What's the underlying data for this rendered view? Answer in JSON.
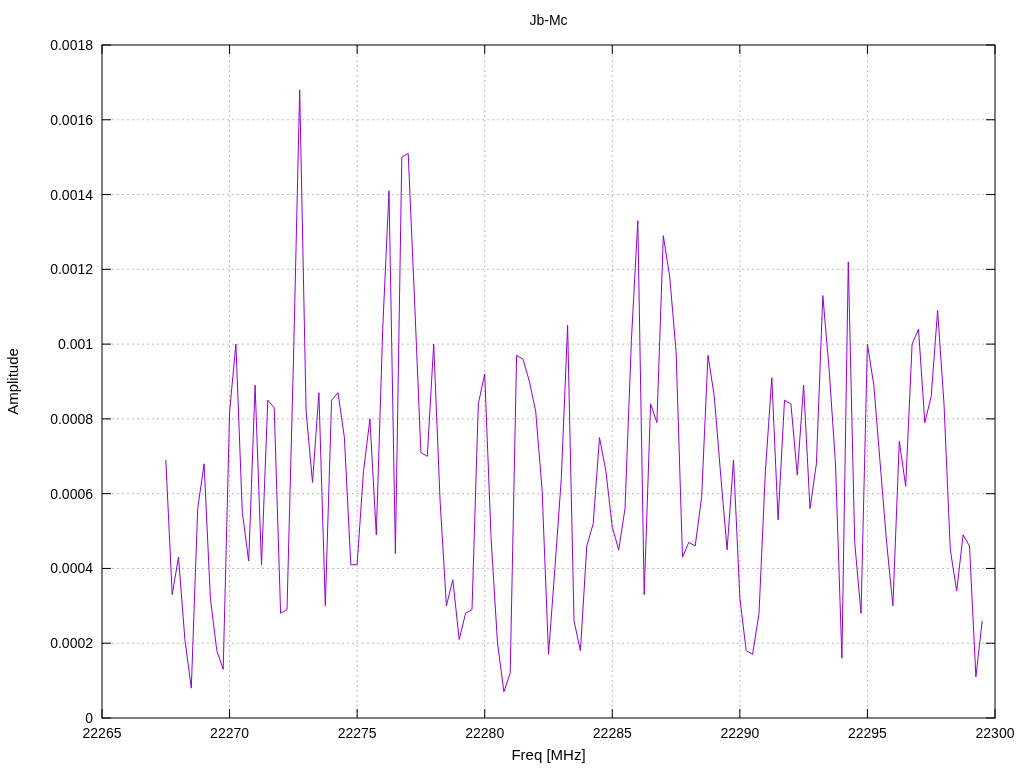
{
  "chart_data": {
    "type": "line",
    "title": "Jb-Mc",
    "xlabel": "Freq [MHz]",
    "ylabel": "Amplitude",
    "xlim": [
      22265,
      22300
    ],
    "grid": true,
    "ylim": [
      0,
      0.0018
    ],
    "xticks": [
      22265,
      22270,
      22275,
      22280,
      22285,
      22290,
      22295,
      22300
    ],
    "yticks": [
      {
        "value": 0,
        "label": "0"
      },
      {
        "value": 0.0002,
        "label": "0.0002"
      },
      {
        "value": 0.0004,
        "label": "0.0004"
      },
      {
        "value": 0.0006,
        "label": "0.0006"
      },
      {
        "value": 0.0008,
        "label": "0.0008"
      },
      {
        "value": 0.001,
        "label": "0.001"
      },
      {
        "value": 0.0012,
        "label": "0.0012"
      },
      {
        "value": 0.0014,
        "label": "0.0014"
      },
      {
        "value": 0.0016,
        "label": "0.0016"
      },
      {
        "value": 0.0018,
        "label": "0.0018"
      }
    ],
    "x": [
      22267.5,
      22267.75,
      22268,
      22268.25,
      22268.5,
      22268.75,
      22269,
      22269.25,
      22269.5,
      22269.75,
      22270,
      22270.25,
      22270.5,
      22270.75,
      22271,
      22271.25,
      22271.5,
      22271.75,
      22272,
      22272.25,
      22272.5,
      22272.75,
      22273,
      22273.25,
      22273.5,
      22273.75,
      22274,
      22274.25,
      22274.5,
      22274.75,
      22275,
      22275.25,
      22275.5,
      22275.75,
      22276,
      22276.25,
      22276.5,
      22276.75,
      22277,
      22277.25,
      22277.5,
      22277.75,
      22278,
      22278.25,
      22278.5,
      22278.75,
      22279,
      22279.25,
      22279.5,
      22279.75,
      22280,
      22280.25,
      22280.5,
      22280.75,
      22281,
      22281.25,
      22281.5,
      22281.75,
      22282,
      22282.25,
      22282.5,
      22282.75,
      22283,
      22283.25,
      22283.5,
      22283.75,
      22284,
      22284.25,
      22284.5,
      22284.75,
      22285,
      22285.25,
      22285.5,
      22285.75,
      22286,
      22286.25,
      22286.5,
      22286.75,
      22287,
      22287.25,
      22287.5,
      22287.75,
      22288,
      22288.25,
      22288.5,
      22288.75,
      22289,
      22289.25,
      22289.5,
      22289.75,
      22290,
      22290.25,
      22290.5,
      22290.75,
      22291,
      22291.25,
      22291.5,
      22291.75,
      22292,
      22292.25,
      22292.5,
      22292.75,
      22293,
      22293.25,
      22293.5,
      22293.75,
      22294,
      22294.25,
      22294.5,
      22294.75,
      22295,
      22295.25,
      22295.5,
      22295.75,
      22296,
      22296.25,
      22296.5,
      22296.75,
      22297,
      22297.25,
      22297.5,
      22297.75,
      22298,
      22298.25,
      22298.5,
      22298.75,
      22299,
      22299.25,
      22299.5
    ],
    "series": [
      {
        "color": "#9400d3",
        "values": [
          0.00069,
          0.00033,
          0.00043,
          0.00021,
          8e-05,
          0.00056,
          0.00068,
          0.00032,
          0.00018,
          0.00013,
          0.00082,
          0.001,
          0.00055,
          0.00042,
          0.00089,
          0.00041,
          0.00085,
          0.00083,
          0.00028,
          0.00029,
          0.00095,
          0.00168,
          0.00082,
          0.00063,
          0.00087,
          0.0003,
          0.00085,
          0.00087,
          0.00075,
          0.00041,
          0.00041,
          0.00066,
          0.0008,
          0.00049,
          0.00104,
          0.00141,
          0.00044,
          0.0015,
          0.00151,
          0.00112,
          0.00071,
          0.0007,
          0.001,
          0.00058,
          0.0003,
          0.00037,
          0.00021,
          0.00028,
          0.00029,
          0.00084,
          0.00092,
          0.00048,
          0.0002,
          7e-05,
          0.00012,
          0.00097,
          0.00096,
          0.0009,
          0.00082,
          0.00061,
          0.00017,
          0.0004,
          0.00064,
          0.00105,
          0.00026,
          0.00018,
          0.00046,
          0.00052,
          0.00075,
          0.00066,
          0.00051,
          0.00045,
          0.00056,
          0.00101,
          0.00133,
          0.00033,
          0.00084,
          0.00079,
          0.00129,
          0.00118,
          0.00098,
          0.00043,
          0.00047,
          0.00046,
          0.00059,
          0.00097,
          0.00086,
          0.00065,
          0.00045,
          0.00069,
          0.00032,
          0.00018,
          0.00017,
          0.00028,
          0.00066,
          0.00091,
          0.00053,
          0.00085,
          0.00084,
          0.00065,
          0.00089,
          0.00056,
          0.00068,
          0.00113,
          0.00093,
          0.00068,
          0.00016,
          0.00122,
          0.00047,
          0.00028,
          0.001,
          0.00089,
          0.00068,
          0.00047,
          0.0003,
          0.00074,
          0.00062,
          0.001,
          0.00104,
          0.00079,
          0.00086,
          0.00109,
          0.00084,
          0.00045,
          0.00034,
          0.00049,
          0.00046,
          0.00011,
          0.00026
        ]
      }
    ]
  }
}
